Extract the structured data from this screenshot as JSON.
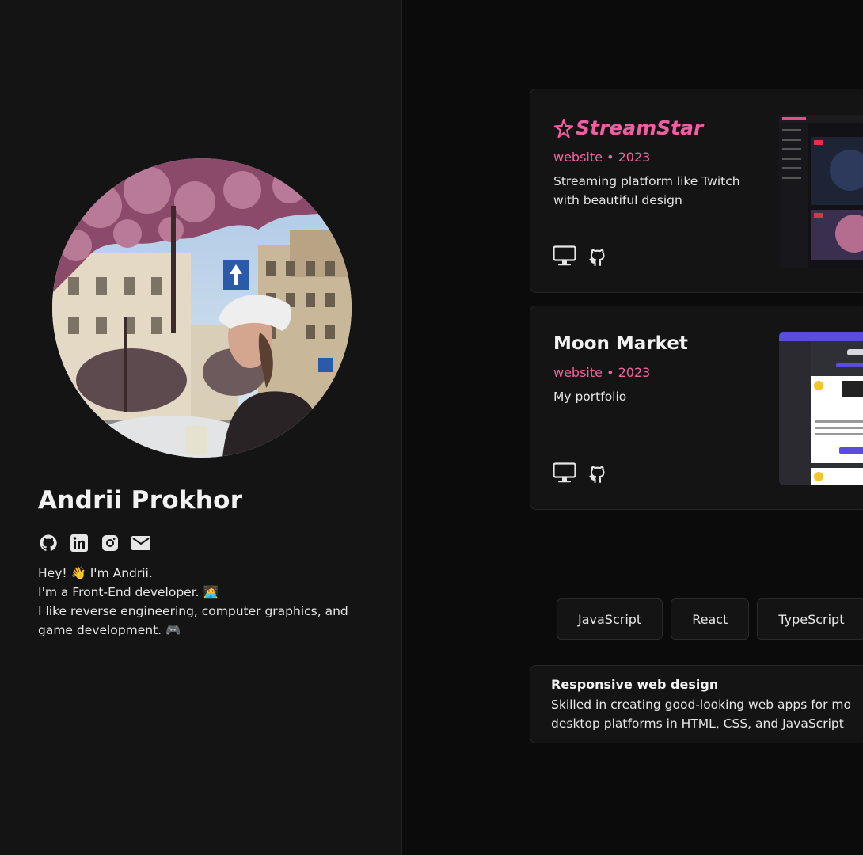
{
  "profile": {
    "name": "Andrii Prokhor",
    "bio": {
      "line1": "Hey! 👋 I'm Andrii.",
      "line2": "I'm a Front-End developer. 🧑‍💻",
      "line3": "I like reverse engineering, computer graphics, and",
      "line4": "game development. 🎮"
    },
    "socials": [
      "github-icon",
      "linkedin-icon",
      "instagram-icon",
      "mail-icon"
    ]
  },
  "projects": [
    {
      "title": "StreamStar",
      "meta": "website • 2023",
      "description": "Streaming platform like Twitch with beautiful design",
      "icons": [
        "monitor-icon",
        "github-icon"
      ]
    },
    {
      "title": "Moon Market",
      "meta": "website • 2023",
      "description": "My portfolio",
      "icons": [
        "monitor-icon",
        "github-icon"
      ]
    }
  ],
  "skills_tabs": [
    "JavaScript",
    "React",
    "TypeScript"
  ],
  "skill_card": {
    "title": "Responsive web design",
    "line1": "Skilled in creating good-looking web apps for mo",
    "line2": "desktop platforms in HTML, CSS, and JavaScript"
  },
  "colors": {
    "accent": "#f0649e",
    "panel": "#141414",
    "background": "#0b0b0c"
  }
}
